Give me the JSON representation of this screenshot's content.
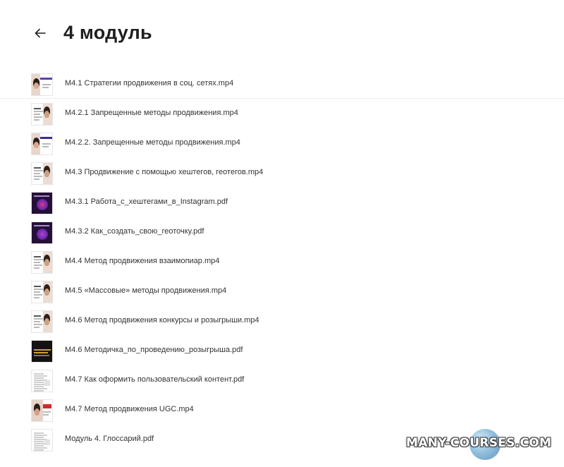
{
  "header": {
    "title": "4 модуль"
  },
  "files": [
    {
      "name": "M4.1 Стратегии продвижения в соц. сетях.mp4",
      "thumb": "video-band",
      "accent": "#5b3fb1"
    },
    {
      "name": "M4.2.1 Запрещенные методы продвижения.mp4",
      "thumb": "video-text",
      "accent": "#c9a184"
    },
    {
      "name": "M4.2.2. Запрещенные методы продвижения.mp4",
      "thumb": "video-band",
      "accent": "#3b2e8c"
    },
    {
      "name": "M4.3 Продвижение с помощью хештегов, геотегов.mp4",
      "thumb": "video-text",
      "accent": "#c9a184"
    },
    {
      "name": "M4.3.1 Работа_с_хештегами_в_Instagram.pdf",
      "thumb": "dark-purple",
      "accent": "#e0338f"
    },
    {
      "name": "M4.3.2 Как_создать_свою_геоточку.pdf",
      "thumb": "dark-purple",
      "accent": "#b33fd8"
    },
    {
      "name": "M4.4 Метод продвижения взаимопиар.mp4",
      "thumb": "video-text",
      "accent": "#c9a184"
    },
    {
      "name": "M4.5 «Массовые» методы продвижения.mp4",
      "thumb": "video-text",
      "accent": "#c9a184"
    },
    {
      "name": "M4.6 Метод продвижения конкурсы и розыгрыши.mp4",
      "thumb": "video-text",
      "accent": "#c9a184"
    },
    {
      "name": "M4.6 Методичка_по_проведению_розыгрыша.pdf",
      "thumb": "dark",
      "accent": "#c8a23a"
    },
    {
      "name": "M4.7 Как оформить пользовательский контент.pdf",
      "thumb": "document",
      "accent": "#9a9a9a"
    },
    {
      "name": "M4.7 Метод продвижения UGC.mp4",
      "thumb": "video-red",
      "accent": "#d12a2a"
    },
    {
      "name": "Модуль 4. Глоссарий.pdf",
      "thumb": "document",
      "accent": "#9a9a9a"
    }
  ],
  "watermark": {
    "text": "MANY-COURSES.COM"
  }
}
